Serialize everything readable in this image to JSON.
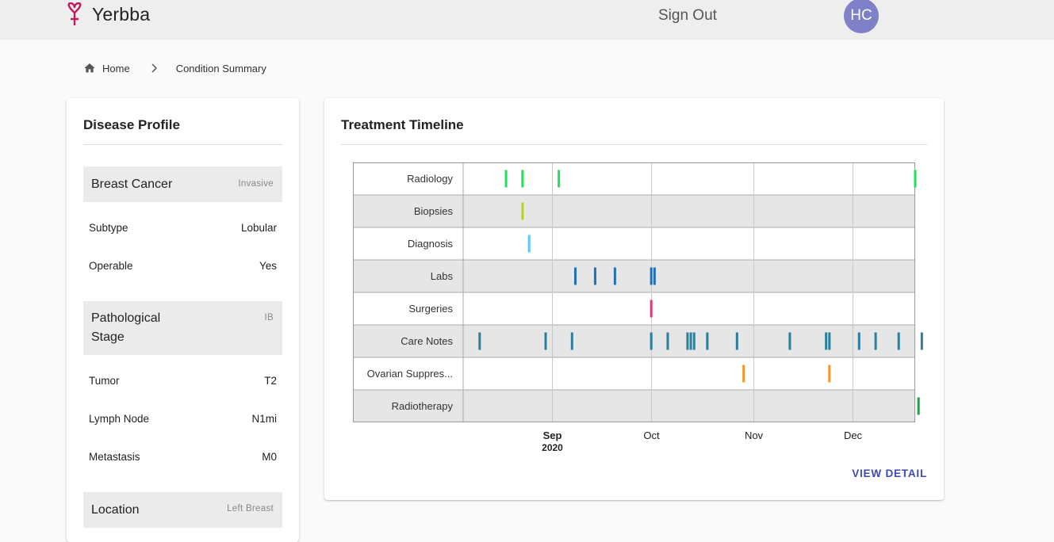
{
  "header": {
    "app_name": "Yerbba",
    "signout_label": "Sign Out",
    "avatar_initials": "HC",
    "brand_color": "#c2185b",
    "avatar_color": "#7e81c8"
  },
  "breadcrumb": {
    "home_label": "Home",
    "current_label": "Condition Summary"
  },
  "disease_profile": {
    "title": "Disease Profile",
    "sections": [
      {
        "name": "Breast Cancer",
        "tag": "Invasive",
        "rows": [
          {
            "label": "Subtype",
            "value": "Lobular"
          },
          {
            "label": "Operable",
            "value": "Yes"
          }
        ]
      },
      {
        "name": "Pathological Stage",
        "tag": "IB",
        "rows": [
          {
            "label": "Tumor",
            "value": "T2"
          },
          {
            "label": "Lymph Node",
            "value": "N1mi"
          },
          {
            "label": "Metastasis",
            "value": "M0"
          }
        ]
      },
      {
        "name": "Location",
        "tag": "Left Breast",
        "rows": []
      }
    ]
  },
  "treatment_timeline": {
    "title": "Treatment Timeline",
    "view_detail_label": "VIEW DETAIL"
  },
  "chart_data": {
    "type": "timeline",
    "x_range": [
      "2020-08-05",
      "2020-12-20"
    ],
    "x_ticks": [
      {
        "label": "Sep",
        "sublabel": "2020",
        "date": "2020-09-01"
      },
      {
        "label": "Oct",
        "date": "2020-10-01"
      },
      {
        "label": "Nov",
        "date": "2020-11-01"
      },
      {
        "label": "Dec",
        "date": "2020-12-01"
      }
    ],
    "rows": [
      {
        "name": "Radiology",
        "color": "#1ee05a",
        "dates": [
          "2020-08-18",
          "2020-08-23",
          "2020-09-03",
          "2020-12-20"
        ]
      },
      {
        "name": "Biopsies",
        "color": "#b5d60e",
        "dates": [
          "2020-08-23"
        ]
      },
      {
        "name": "Diagnosis",
        "color": "#5ac8fa",
        "dates": [
          "2020-08-25"
        ]
      },
      {
        "name": "Labs",
        "color": "#1f70b8",
        "dates": [
          "2020-09-08",
          "2020-09-14",
          "2020-09-20",
          "2020-10-01",
          "2020-10-02"
        ]
      },
      {
        "name": "Surgeries",
        "color": "#e0367a",
        "dates": [
          "2020-10-01"
        ]
      },
      {
        "name": "Care Notes",
        "color": "#2b7f99",
        "dates": [
          "2020-08-10",
          "2020-08-30",
          "2020-09-07",
          "2020-10-01",
          "2020-10-06",
          "2020-10-12",
          "2020-10-13",
          "2020-10-14",
          "2020-10-18",
          "2020-10-27",
          "2020-11-12",
          "2020-11-23",
          "2020-11-24",
          "2020-12-03",
          "2020-12-08",
          "2020-12-15",
          "2020-12-22"
        ]
      },
      {
        "name": "Ovarian Suppres...",
        "color": "#f5962a",
        "dates": [
          "2020-10-29",
          "2020-11-24"
        ]
      },
      {
        "name": "Radiotherapy",
        "color": "#1fa04a",
        "dates": [
          "2020-12-21"
        ]
      }
    ]
  }
}
